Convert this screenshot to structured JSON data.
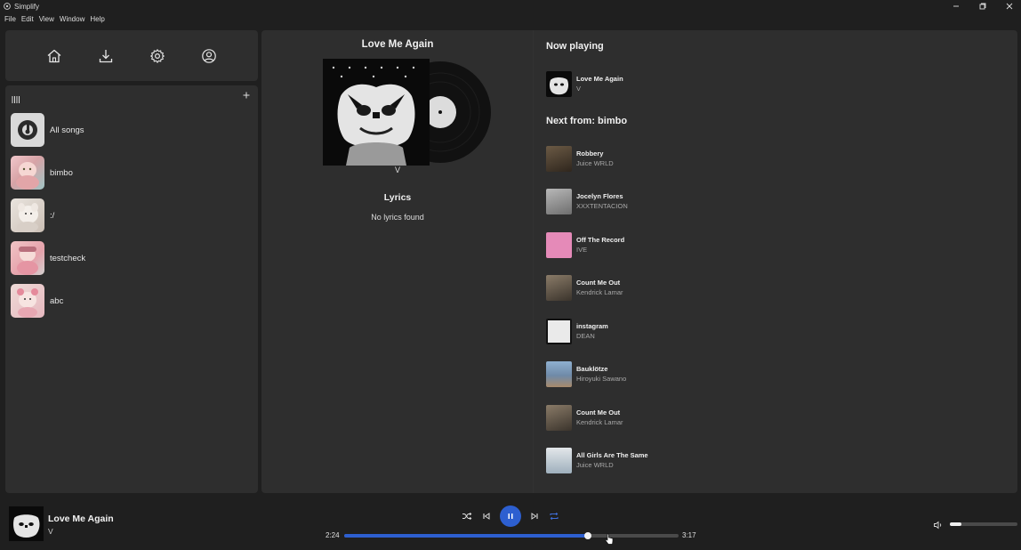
{
  "window": {
    "title": "Simplify"
  },
  "menu": [
    "File",
    "Edit",
    "View",
    "Window",
    "Help"
  ],
  "nav": {
    "icons": [
      "home-icon",
      "download-icon",
      "settings-icon",
      "account-icon"
    ]
  },
  "library": {
    "playlists": [
      {
        "label": "All songs",
        "thumb": "all-songs-logo"
      },
      {
        "label": "bimbo",
        "thumb": "pink-art"
      },
      {
        "label": ":/",
        "thumb": "white-art"
      },
      {
        "label": "testcheck",
        "thumb": "pink-art"
      },
      {
        "label": "abc",
        "thumb": "pink-art"
      }
    ]
  },
  "center": {
    "title": "Love Me Again",
    "artist": "V",
    "lyrics_heading": "Lyrics",
    "lyrics_text": "No lyrics found"
  },
  "now_playing": {
    "heading": "Now playing",
    "track": {
      "title": "Love Me Again",
      "artist": "V"
    }
  },
  "queue": {
    "heading": "Next from: bimbo",
    "tracks": [
      {
        "title": "Robbery",
        "artist": "Juice WRLD",
        "color": "#5a4a3a"
      },
      {
        "title": "Jocelyn Flores",
        "artist": "XXXTENTACION",
        "color": "#9a9a9a"
      },
      {
        "title": "Off The Record",
        "artist": "IVE",
        "color": "#e58ab8"
      },
      {
        "title": "Count Me Out",
        "artist": "Kendrick Lamar",
        "color": "#7a6e60"
      },
      {
        "title": "instagram",
        "artist": "DEAN",
        "color": "#eaeaea"
      },
      {
        "title": "Bauklötze",
        "artist": "Hiroyuki Sawano",
        "color": "#6f8aa8"
      },
      {
        "title": "Count Me Out",
        "artist": "Kendrick Lamar",
        "color": "#7a6e60"
      },
      {
        "title": "All Girls Are The Same",
        "artist": "Juice WRLD",
        "color": "#cfd6dc"
      }
    ]
  },
  "player": {
    "title": "Love Me Again",
    "artist": "V",
    "time_current": "2:24",
    "time_total": "3:17",
    "progress": 0.728,
    "volume": 0.17,
    "accent": "#2d5fd0"
  }
}
